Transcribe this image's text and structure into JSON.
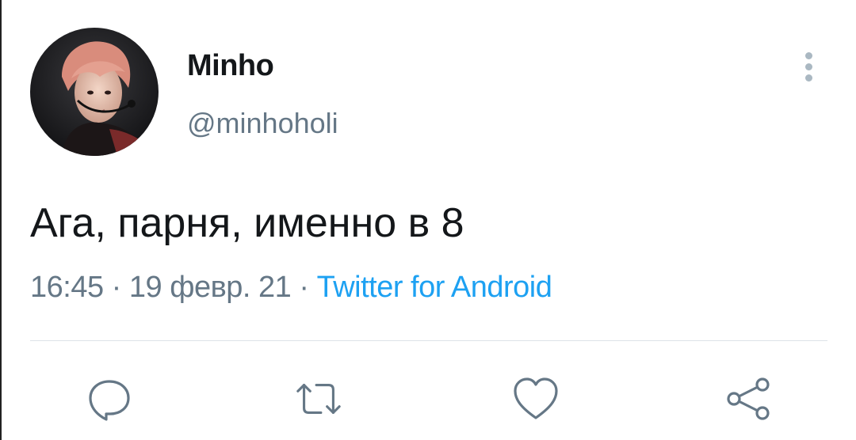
{
  "author": {
    "display_name": "Minho",
    "handle": "@minhoholi"
  },
  "tweet": {
    "text": "Ага, парня, именно в 8"
  },
  "meta": {
    "time": "16:45",
    "separator1": " · ",
    "date": "19 февр. 21",
    "separator2": " · ",
    "source": "Twitter for Android"
  },
  "actions": [
    {
      "icon": "reply-icon"
    },
    {
      "icon": "retweet-icon"
    },
    {
      "icon": "like-icon"
    },
    {
      "icon": "share-icon"
    }
  ],
  "colors": {
    "text": "#14171a",
    "secondary": "#657786",
    "link": "#1da1f2",
    "icon": "#657786",
    "divider": "#dde3e8"
  }
}
